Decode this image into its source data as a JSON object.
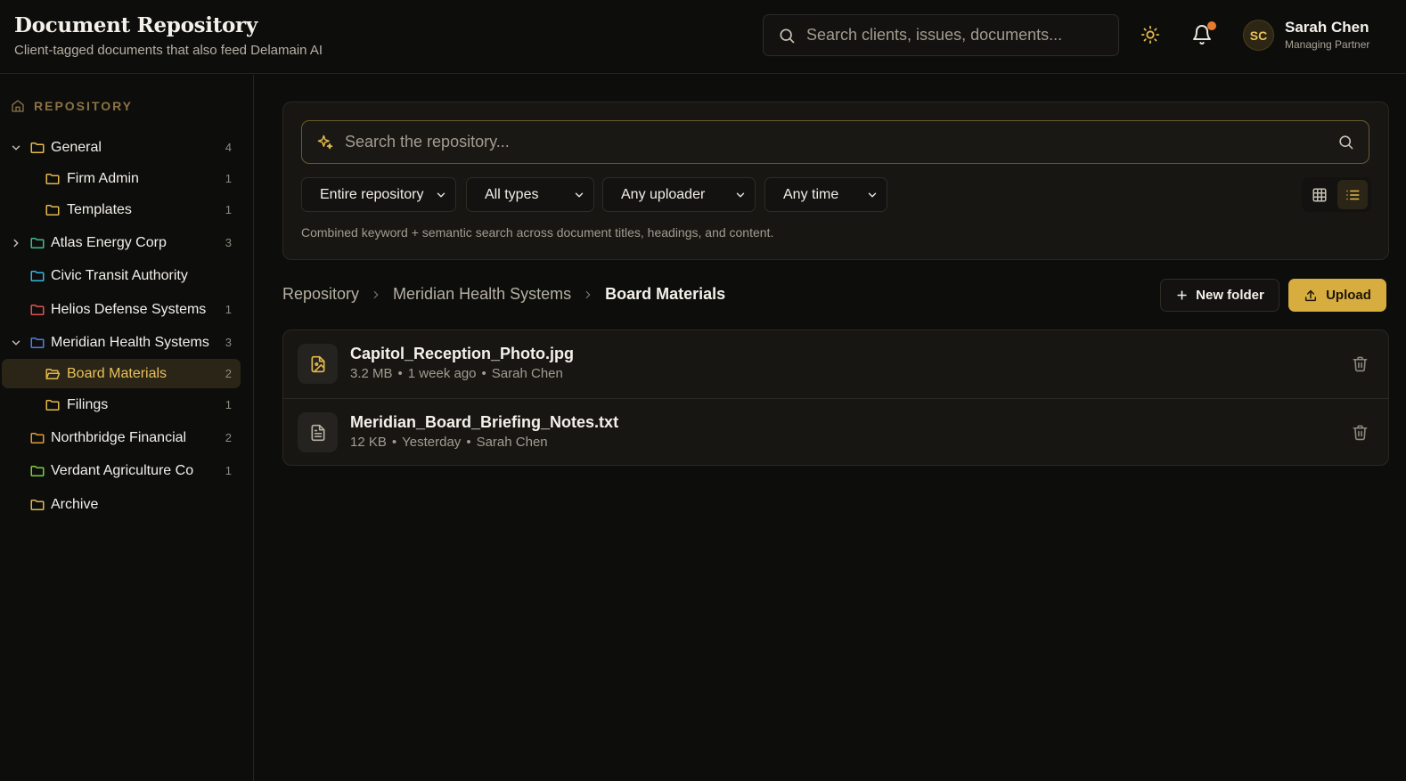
{
  "header": {
    "title": "Document Repository",
    "subtitle": "Client-tagged documents that also feed Delamain AI",
    "search_placeholder": "Search clients, issues, documents...",
    "user": {
      "initials": "SC",
      "name": "Sarah Chen",
      "role": "Managing Partner"
    },
    "notification_dot_color": "#e97a2e"
  },
  "sidebar": {
    "heading": "REPOSITORY",
    "items": [
      {
        "name": "General",
        "count": "4",
        "expanded": true,
        "folder_color": "#e3b94a"
      },
      {
        "name": "Firm Admin",
        "count": "1",
        "folder_color": "#e3b94a"
      },
      {
        "name": "Templates",
        "count": "1",
        "folder_color": "#e3b94a"
      },
      {
        "name": "Atlas Energy Corp",
        "count": "3",
        "expanded": false,
        "folder_color": "#3fbf8a"
      },
      {
        "name": "Civic Transit Authority",
        "count": "",
        "folder_color": "#38b6e0"
      },
      {
        "name": "Helios Defense Systems",
        "count": "1",
        "folder_color": "#e05252"
      },
      {
        "name": "Meridian Health Systems",
        "count": "3",
        "expanded": true,
        "folder_color": "#4f7fe8"
      },
      {
        "name": "Board Materials",
        "count": "2",
        "active": true,
        "folder_color": "#e3b94a"
      },
      {
        "name": "Filings",
        "count": "1",
        "folder_color": "#e3b94a"
      },
      {
        "name": "Northbridge Financial",
        "count": "2",
        "folder_color": "#e39a3a"
      },
      {
        "name": "Verdant Agriculture Co",
        "count": "1",
        "folder_color": "#7ccf3a"
      },
      {
        "name": "Archive",
        "count": "",
        "folder_color": "#e3b94a"
      }
    ]
  },
  "search_panel": {
    "placeholder": "Search the repository...",
    "filters": [
      "Entire repository",
      "All types",
      "Any uploader",
      "Any time"
    ],
    "hint": "Combined keyword + semantic search across document titles, headings, and content.",
    "view_mode": "list"
  },
  "breadcrumb": [
    "Repository",
    "Meridian Health Systems",
    "Board Materials"
  ],
  "actions": {
    "new_folder": "New folder",
    "upload": "Upload"
  },
  "files": [
    {
      "name": "Capitol_Reception_Photo.jpg",
      "size": "3.2 MB",
      "time": "1 week ago",
      "uploader": "Sarah Chen",
      "icon": "image-file-icon"
    },
    {
      "name": "Meridian_Board_Briefing_Notes.txt",
      "size": "12 KB",
      "time": "Yesterday",
      "uploader": "Sarah Chen",
      "icon": "text-file-icon"
    }
  ],
  "colors": {
    "accent": "#d8ad3f",
    "background": "#0d0d0c",
    "panel": "#171613"
  }
}
